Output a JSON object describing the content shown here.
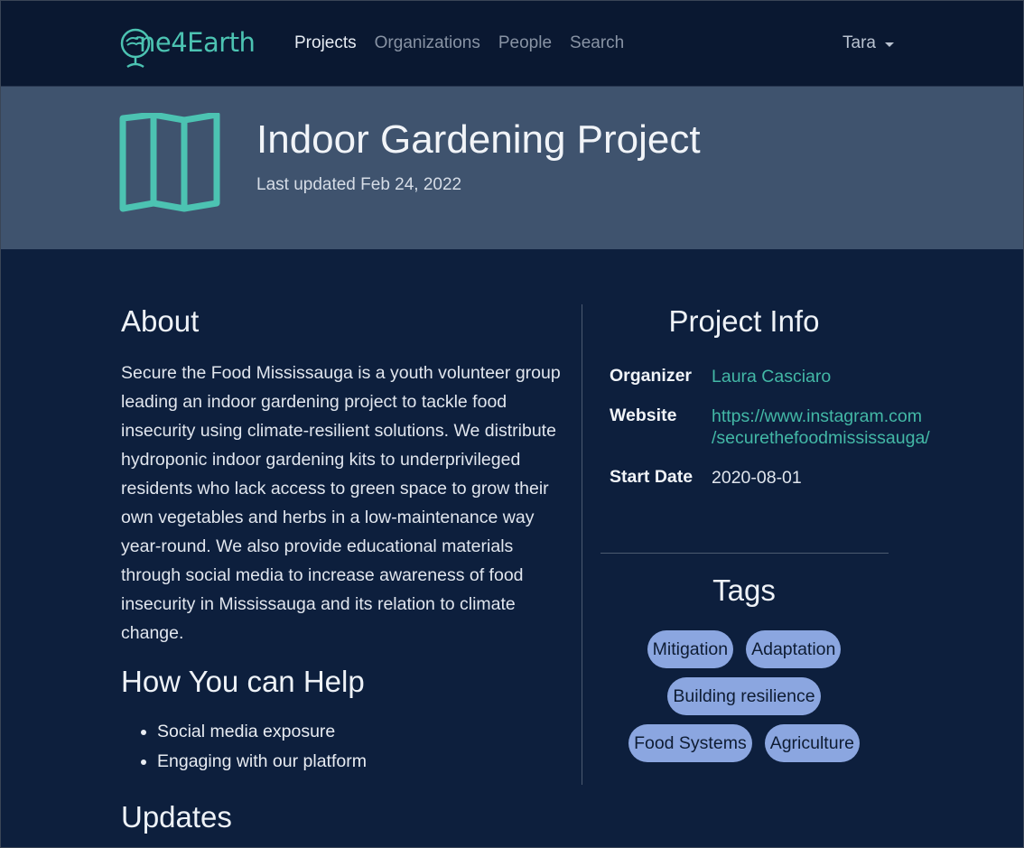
{
  "navbar": {
    "logo_text": "ne4Earth",
    "links": [
      "Projects",
      "Organizations",
      "People",
      "Search"
    ],
    "user": "Tara"
  },
  "hero": {
    "title": "Indoor Gardening Project",
    "updated": "Last updated Feb 24, 2022"
  },
  "about": {
    "heading": "About",
    "text": "Secure the Food Mississauga is a youth volunteer group leading an indoor gardening project to tackle food insecurity using climate-resilient solutions. We distribute hydroponic indoor gardening kits to underprivileged residents who lack access to green space to grow their own vegetables and herbs in a low-maintenance way year-round. We also provide educational materials through social media to increase awareness of food insecurity in Mississauga and its relation to climate change."
  },
  "help": {
    "heading": "How You can Help",
    "items": [
      "Social media exposure",
      "Engaging with our platform"
    ]
  },
  "updates": {
    "heading": "Updates"
  },
  "project_info": {
    "heading": "Project Info",
    "organizer_label": "Organizer",
    "organizer": "Laura Casciaro",
    "website_label": "Website",
    "website_line1": "https://www.instagram.com",
    "website_line2": "/securethefoodmississauga/",
    "start_label": "Start Date",
    "start_date": "2020-08-01"
  },
  "tags": {
    "heading": "Tags",
    "items": [
      "Mitigation",
      "Adaptation",
      "Building resilience",
      "Food Systems",
      "Agriculture"
    ]
  },
  "colors": {
    "navbar_bg": "#0a1831",
    "page_bg": "#0d1f3d",
    "hero_bg": "#3f536e",
    "accent": "#4cc3b2",
    "tag_bg": "#8ba6e0"
  },
  "icons": {
    "logo": "globe-logo-icon",
    "hero": "map-icon",
    "user_menu": "caret-down-icon"
  }
}
